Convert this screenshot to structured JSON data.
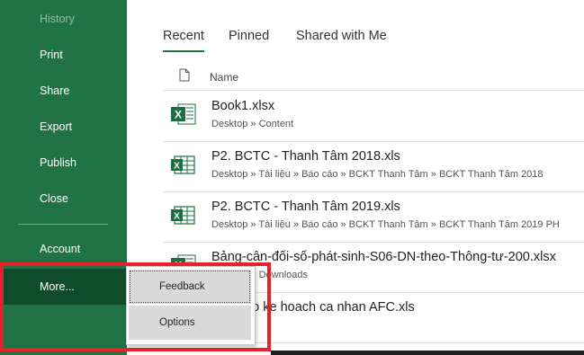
{
  "sidebar": {
    "items": [
      {
        "label": "History"
      },
      {
        "label": "Print"
      },
      {
        "label": "Share"
      },
      {
        "label": "Export"
      },
      {
        "label": "Publish"
      },
      {
        "label": "Close"
      },
      {
        "label": "Account"
      },
      {
        "label": "More..."
      }
    ]
  },
  "tabs": [
    {
      "label": "Recent"
    },
    {
      "label": "Pinned"
    },
    {
      "label": "Shared with Me"
    }
  ],
  "file_list": {
    "header": {
      "name_col": "Name"
    },
    "files": [
      {
        "name": "Book1.xlsx",
        "path": "Desktop » Content",
        "icon": "excel-xlsx-icon"
      },
      {
        "name": "P2. BCTC - Thanh Tâm 2018.xls",
        "path": "Desktop » Tài liệu » Báo cáo » BCKT Thanh Tâm » BCKT Thanh Tâm 2018",
        "icon": "excel-xls-icon"
      },
      {
        "name": "P2. BCTC - Thanh Tâm 2019.xls",
        "path": "Desktop » Tài liệu » Báo cáo » BCKT Thanh Tâm » BCKT Thanh Tâm 2019 PH",
        "icon": "excel-xls-icon"
      },
      {
        "name": "Bảng-cân-đối-số-phát-sinh-S06-DN-theo-Thông-tư-200.xlsx",
        "path": "Desktop » Downloads",
        "icon": "excel-xlsx-icon"
      },
      {
        "name": "Bao cao ke hoach ca nhan AFC.xls",
        "path": "",
        "icon": "excel-xls-icon"
      }
    ]
  },
  "popup_menu": {
    "items": [
      {
        "label": "Feedback"
      },
      {
        "label": "Options"
      }
    ]
  },
  "colors": {
    "sidebar_bg": "#217346",
    "sidebar_active": "#0f4d2a",
    "highlight_box": "#e8212b",
    "excel_green": "#1d6f42"
  }
}
